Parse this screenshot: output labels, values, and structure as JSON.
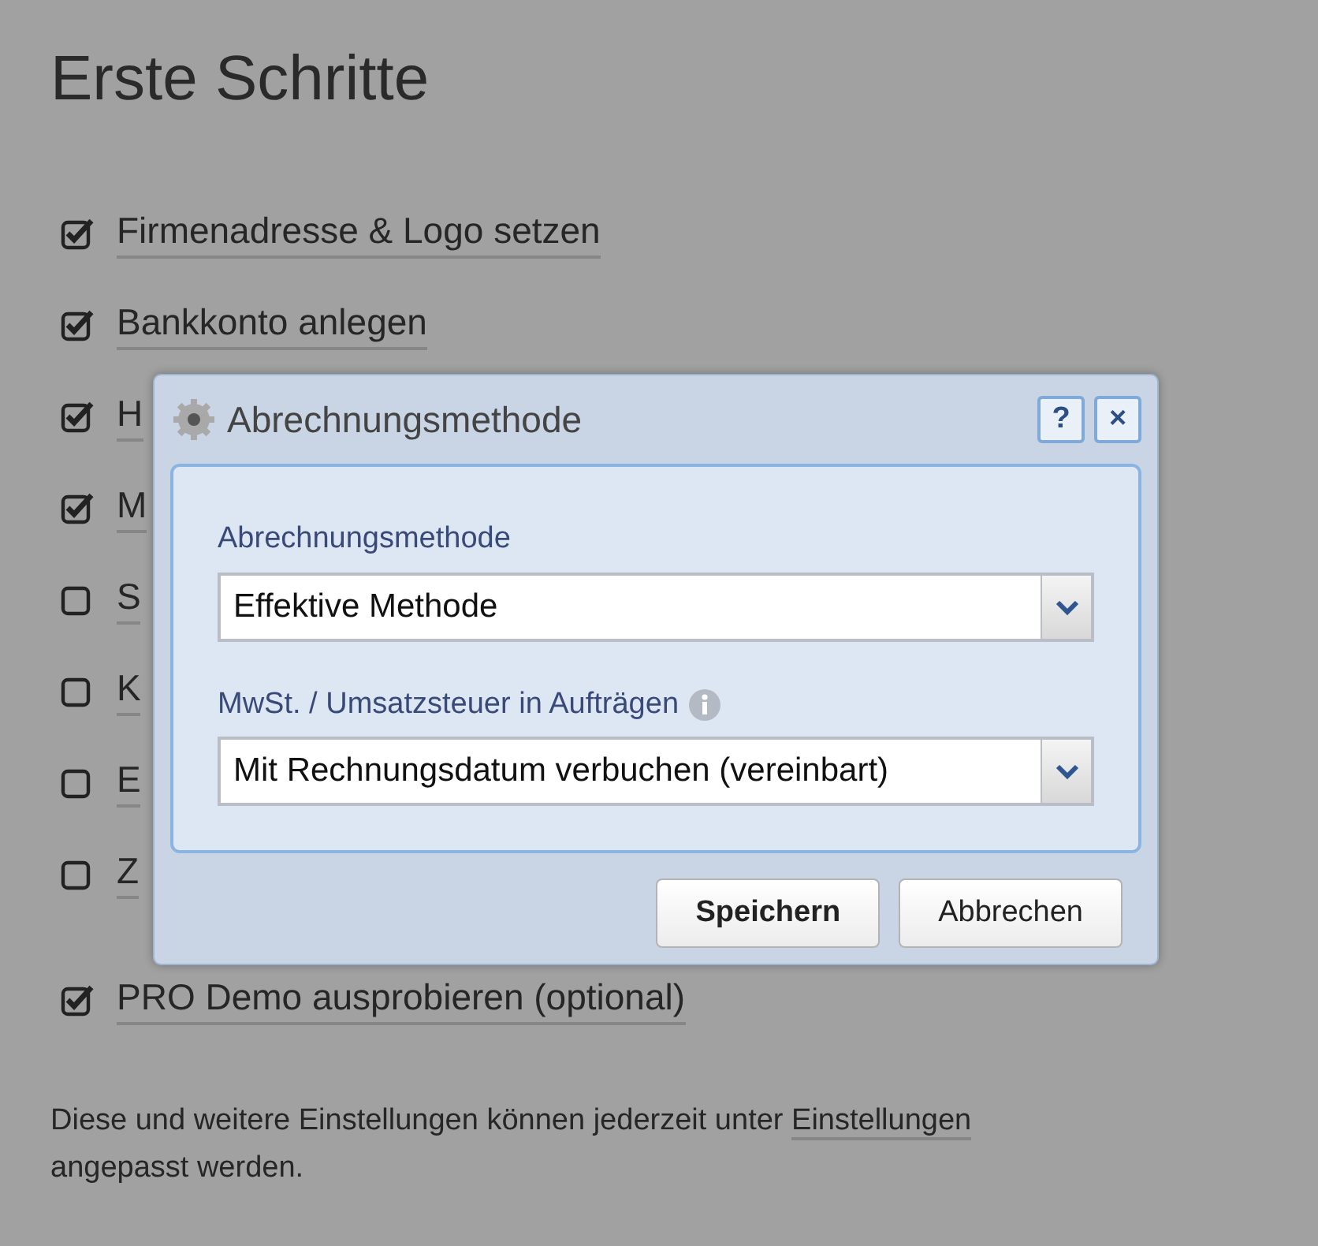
{
  "page": {
    "title": "Erste Schritte"
  },
  "steps": [
    {
      "label": "Firmenadresse & Logo setzen",
      "checked": true
    },
    {
      "label": "Bankkonto anlegen",
      "checked": true
    },
    {
      "label": "H",
      "checked": true
    },
    {
      "label": "M",
      "checked": true
    },
    {
      "label": "S",
      "checked": false
    },
    {
      "label": "K",
      "checked": false
    },
    {
      "label": "E",
      "checked": false
    },
    {
      "label": "Z",
      "checked": false
    },
    {
      "label": "PRO Demo ausprobieren (optional)",
      "checked": true
    }
  ],
  "footer": {
    "text": "Diese und weitere Einstellungen können jederzeit unter",
    "link": "Einstellungen",
    "text_after": "angepasst werden."
  },
  "dialog": {
    "title": "Abrechnungsmethode",
    "help": "?",
    "close": "×",
    "fields": [
      {
        "label": "Abrechnungsmethode",
        "value": "Effektive Methode",
        "info": false
      },
      {
        "label": "MwSt. / Umsatzsteuer in Aufträgen",
        "value": "Mit Rechnungsdatum verbuchen (vereinbart)",
        "info": true
      }
    ],
    "buttons": [
      {
        "label": "Speichern",
        "primary": true
      },
      {
        "label": "Abbrechen",
        "primary": false
      }
    ]
  }
}
